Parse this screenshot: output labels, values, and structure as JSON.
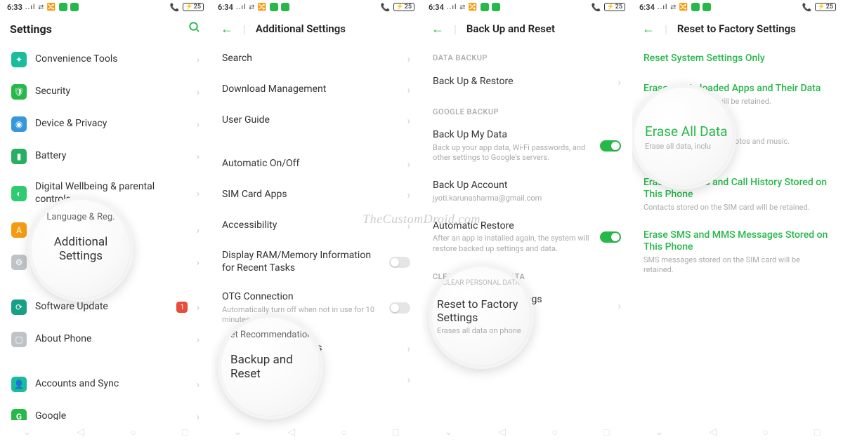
{
  "status": {
    "time1": "6:33",
    "time2": "6:34",
    "signal": "..ıl",
    "nfc": "⇄",
    "battery": "25",
    "phone": "📞"
  },
  "watermark": "TheCustomDroid.com",
  "s1": {
    "title": "Settings",
    "items": {
      "i0": "Convenience Tools",
      "i1": "Security",
      "i2": "Device & Privacy",
      "i3": "Battery",
      "i4": "Digital Wellbeing & parental controls",
      "i5": "Language & Reg.",
      "i6": "Additional Settings",
      "i7": "Software Update",
      "i7b": "1",
      "i8": "About Phone",
      "i9": "Accounts and Sync",
      "i10": "Google"
    }
  },
  "s2": {
    "title": "Additional Settings",
    "items": {
      "i0": "Search",
      "i1": "Download Management",
      "i2": "User Guide",
      "i3": "Automatic On/Off",
      "i4": "SIM Card Apps",
      "i5": "Accessibility",
      "i6": "Display RAM/Memory Information for Recent Tasks",
      "i7": "OTG Connection",
      "i7s": "Automatically turn off when not in use for 10 minutes.",
      "i8": "Get Recommendations",
      "i9": "Backup and Reset"
    }
  },
  "s3": {
    "title": "Back Up and Reset",
    "sec1": "DATA BACKUP",
    "sec2": "GOOGLE BACKUP",
    "sec3": "CLEAR PERSONAL DATA",
    "items": {
      "i0": "Back Up & Restore",
      "i1": "Back Up My Data",
      "i1s": "Back up your app data, Wi-Fi passwords, and other settings to Google's servers.",
      "i2": "Back Up Account",
      "i2s": "jyoti.karunasharma@gmail.com",
      "i3": "Automatic Restore",
      "i3s": "After an app is installed again, the system will restore backed up settings and data.",
      "i4": "Reset to Factory Settings",
      "i4s": "Erases all data on phone"
    }
  },
  "s4": {
    "title": "Reset to Factory Settings",
    "items": {
      "i0": "Reset System Settings Only",
      "i1": "Erase music loaded Apps and Their Data",
      "i1s": "… other non-app data will be retained.",
      "i2": "Erase All Data",
      "i2s": "Erase all data, including photos and music.",
      "i3": "Erase Contacts and Call History Stored on This Phone",
      "i3s": "Contacts stored on the SIM card will be retained.",
      "i4": "Erase SMS and MMS Messages Stored on This Phone",
      "i4s": "SMS messages stored on the SIM card will be retained."
    }
  },
  "mag": {
    "m1above": "Language & Reg.",
    "m1": "Additional Settings",
    "m2above": "Get Recommendations",
    "m2": "Backup and Reset",
    "m3above": "CLEAR PERSONAL DATA",
    "m3": "Reset to Factory Settings",
    "m3s": "Erases all data on phone",
    "m4": "Erase All Data",
    "m4s": "Erase all data, inclu"
  }
}
